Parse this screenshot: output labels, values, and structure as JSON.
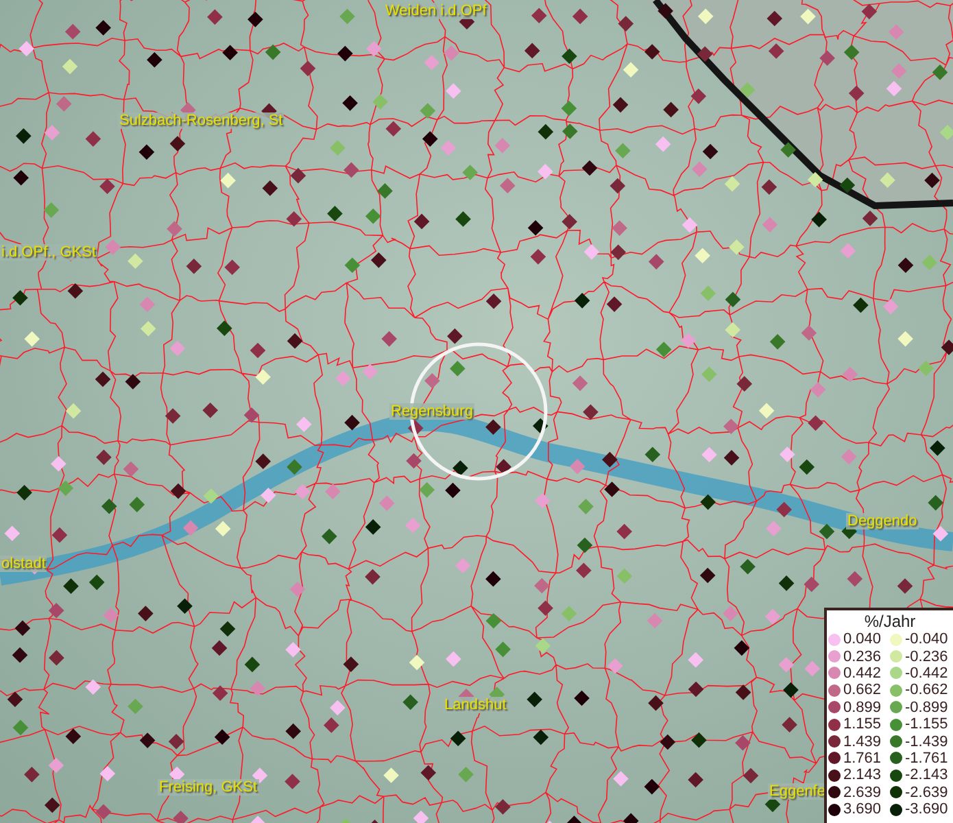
{
  "map": {
    "labels": [
      "Weiden i.d.OPf",
      "Sulzbach-Rosenberg, St",
      "i.d.OPf., GKSt",
      "Regensburg",
      "olstadt",
      "Deggendo",
      "Landshut",
      "Freising, GKSt",
      "Eggenfe"
    ]
  },
  "legend": {
    "title": "%/Jahr",
    "positive": [
      {
        "value": "0.040",
        "color": "#f8c0f0"
      },
      {
        "value": "0.236",
        "color": "#e8a0d0"
      },
      {
        "value": "0.442",
        "color": "#d888b0"
      },
      {
        "value": "0.662",
        "color": "#c06888"
      },
      {
        "value": "0.899",
        "color": "#a84868"
      },
      {
        "value": "1.155",
        "color": "#903048"
      },
      {
        "value": "1.439",
        "color": "#782838"
      },
      {
        "value": "1.761",
        "color": "#601828"
      },
      {
        "value": "2.143",
        "color": "#481018"
      },
      {
        "value": "2.639",
        "color": "#300810"
      },
      {
        "value": "3.690",
        "color": "#200008"
      }
    ],
    "negative": [
      {
        "value": "-0.040",
        "color": "#f0f8c0"
      },
      {
        "value": "-0.236",
        "color": "#d0e8a0"
      },
      {
        "value": "-0.442",
        "color": "#a8d888"
      },
      {
        "value": "-0.662",
        "color": "#88c068"
      },
      {
        "value": "-0.899",
        "color": "#68a850"
      },
      {
        "value": "-1.155",
        "color": "#489038"
      },
      {
        "value": "-1.439",
        "color": "#387828"
      },
      {
        "value": "-1.761",
        "color": "#286020"
      },
      {
        "value": "-2.143",
        "color": "#184810"
      },
      {
        "value": "-2.639",
        "color": "#103008"
      },
      {
        "value": "-3.690",
        "color": "#082008"
      }
    ]
  }
}
